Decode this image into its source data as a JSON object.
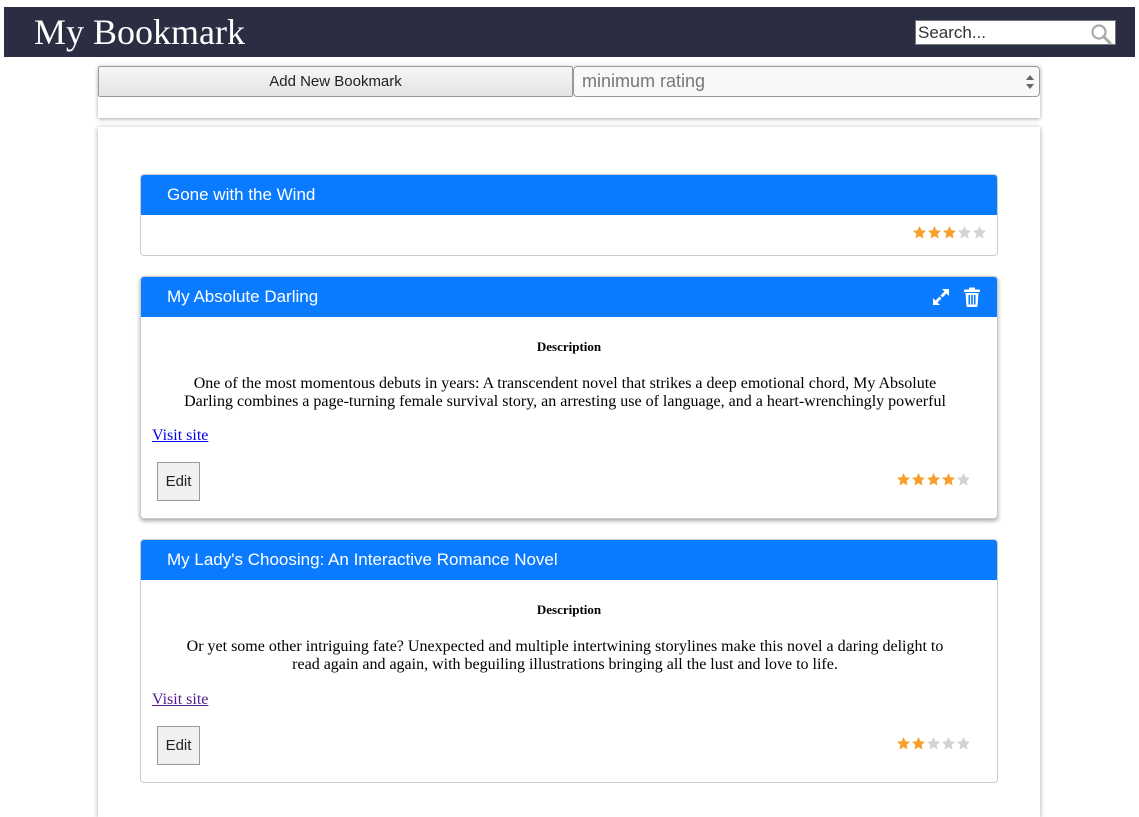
{
  "app": {
    "title": "My Bookmark"
  },
  "search": {
    "placeholder": "Search..."
  },
  "toolbar": {
    "add_label": "Add New Bookmark",
    "rating_select": {
      "placeholder": "minimum rating"
    }
  },
  "colors": {
    "topbar": "#2b2e42",
    "card_header": "#0a7bff",
    "star_filled": "#f7a12c",
    "star_empty": "#d3d3d3"
  },
  "bookmarks": [
    {
      "title": "Gone with the Wind",
      "expanded": false,
      "rating": 3,
      "max_rating": 5
    },
    {
      "title": "My Absolute Darling",
      "expanded": true,
      "show_tools": true,
      "description_label": "Description",
      "description": "One of the most momentous debuts in years: A transcendent novel that strikes a deep emotional chord, My Absolute Darling combines a page-turning female survival story, an arresting use of language, and a heart-wrenchingly powerful",
      "link_label": "Visit site",
      "edit_label": "Edit",
      "rating": 4,
      "max_rating": 5,
      "icons": [
        "expand-icon",
        "trash-icon"
      ]
    },
    {
      "title": "My Lady's Choosing: An Interactive Romance Novel",
      "expanded": true,
      "show_tools": false,
      "description_label": "Description",
      "description": "Or yet some other intriguing fate? Unexpected and multiple intertwining storylines make this novel a daring delight to read again and again, with beguiling illustrations bringing all the lust and love to life.",
      "link_label": "Visit site",
      "edit_label": "Edit",
      "rating": 2,
      "max_rating": 5
    }
  ]
}
